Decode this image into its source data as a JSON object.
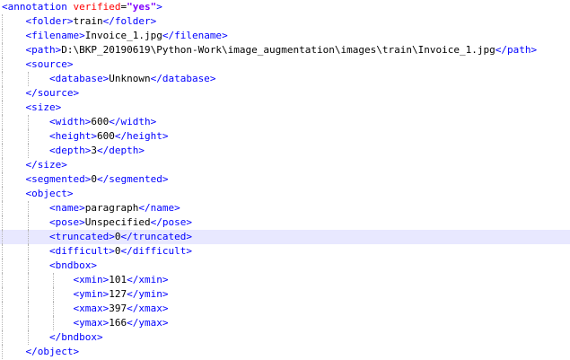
{
  "editor": {
    "lines": [
      {
        "indent": 0,
        "kind": "open-attr",
        "tag": "annotation",
        "attr_name": "verified",
        "attr_value": "\"yes\""
      },
      {
        "indent": 1,
        "kind": "element",
        "tag": "folder",
        "text": "train"
      },
      {
        "indent": 1,
        "kind": "element",
        "tag": "filename",
        "text": "Invoice_1.jpg"
      },
      {
        "indent": 1,
        "kind": "element",
        "tag": "path",
        "text": "D:\\BKP_20190619\\Python-Work\\image_augmentation\\images\\train\\Invoice_1.jpg"
      },
      {
        "indent": 1,
        "kind": "open",
        "tag": "source"
      },
      {
        "indent": 2,
        "kind": "element",
        "tag": "database",
        "text": "Unknown"
      },
      {
        "indent": 1,
        "kind": "close",
        "tag": "source"
      },
      {
        "indent": 1,
        "kind": "open",
        "tag": "size"
      },
      {
        "indent": 2,
        "kind": "element",
        "tag": "width",
        "text": "600"
      },
      {
        "indent": 2,
        "kind": "element",
        "tag": "height",
        "text": "600"
      },
      {
        "indent": 2,
        "kind": "element",
        "tag": "depth",
        "text": "3"
      },
      {
        "indent": 1,
        "kind": "close",
        "tag": "size"
      },
      {
        "indent": 1,
        "kind": "element",
        "tag": "segmented",
        "text": "0"
      },
      {
        "indent": 1,
        "kind": "open",
        "tag": "object"
      },
      {
        "indent": 2,
        "kind": "element",
        "tag": "name",
        "text": "paragraph"
      },
      {
        "indent": 2,
        "kind": "element",
        "tag": "pose",
        "text": "Unspecified"
      },
      {
        "indent": 2,
        "kind": "element",
        "tag": "truncated",
        "text": "0",
        "current": true
      },
      {
        "indent": 2,
        "kind": "element",
        "tag": "difficult",
        "text": "0"
      },
      {
        "indent": 2,
        "kind": "open",
        "tag": "bndbox"
      },
      {
        "indent": 3,
        "kind": "element",
        "tag": "xmin",
        "text": "101"
      },
      {
        "indent": 3,
        "kind": "element",
        "tag": "ymin",
        "text": "127"
      },
      {
        "indent": 3,
        "kind": "element",
        "tag": "xmax",
        "text": "397"
      },
      {
        "indent": 3,
        "kind": "element",
        "tag": "ymax",
        "text": "166"
      },
      {
        "indent": 2,
        "kind": "close",
        "tag": "bndbox"
      },
      {
        "indent": 1,
        "kind": "close",
        "tag": "object"
      }
    ]
  },
  "colors": {
    "tag": "#0000ff",
    "attribute": "#ff0000",
    "attribute_value": "#8000ff",
    "text": "#000000",
    "current_line": "#e8e8ff",
    "indent_guide": "#b4b4b4"
  }
}
